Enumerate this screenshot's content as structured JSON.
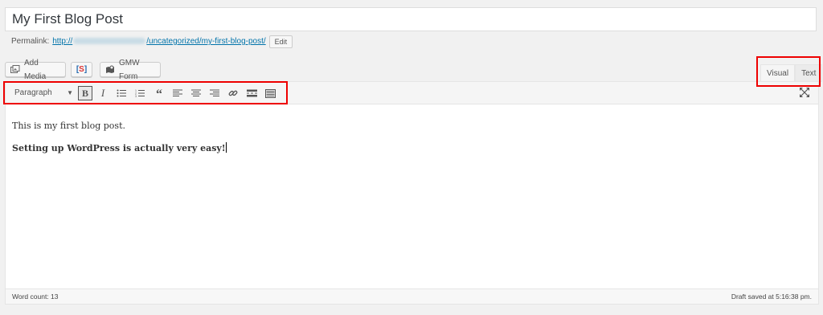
{
  "title": {
    "value": "My First Blog Post"
  },
  "permalink": {
    "label": "Permalink:",
    "url_prefix": "http://",
    "url_path": "/uncategorized/my-first-blog-post/",
    "edit_label": "Edit"
  },
  "media_buttons": [
    {
      "label": "Add Media",
      "icon": "add-media-icon"
    },
    {
      "label": "",
      "icon": "s-shortcode-icon"
    },
    {
      "label": "GMW Form",
      "icon": "gmw-form-icon"
    }
  ],
  "editor_tabs": {
    "visual": "Visual",
    "text": "Text",
    "active": "visual"
  },
  "toolbar": {
    "format_select": "Paragraph",
    "buttons": [
      "bold-icon",
      "italic-icon",
      "bullet-list-icon",
      "numbered-list-icon",
      "blockquote-icon",
      "align-left-icon",
      "align-center-icon",
      "align-right-icon",
      "link-icon",
      "read-more-icon",
      "toolbar-toggle-icon"
    ],
    "bold_active": true
  },
  "content": {
    "paragraph1": "This is my first blog post.",
    "paragraph2": "Setting up WordPress is actually very easy!"
  },
  "status": {
    "word_count": "Word count: 13",
    "draft_saved": "Draft saved at 5:16:38 pm."
  },
  "colors": {
    "highlight": "#e00000",
    "link": "#0073aa"
  }
}
